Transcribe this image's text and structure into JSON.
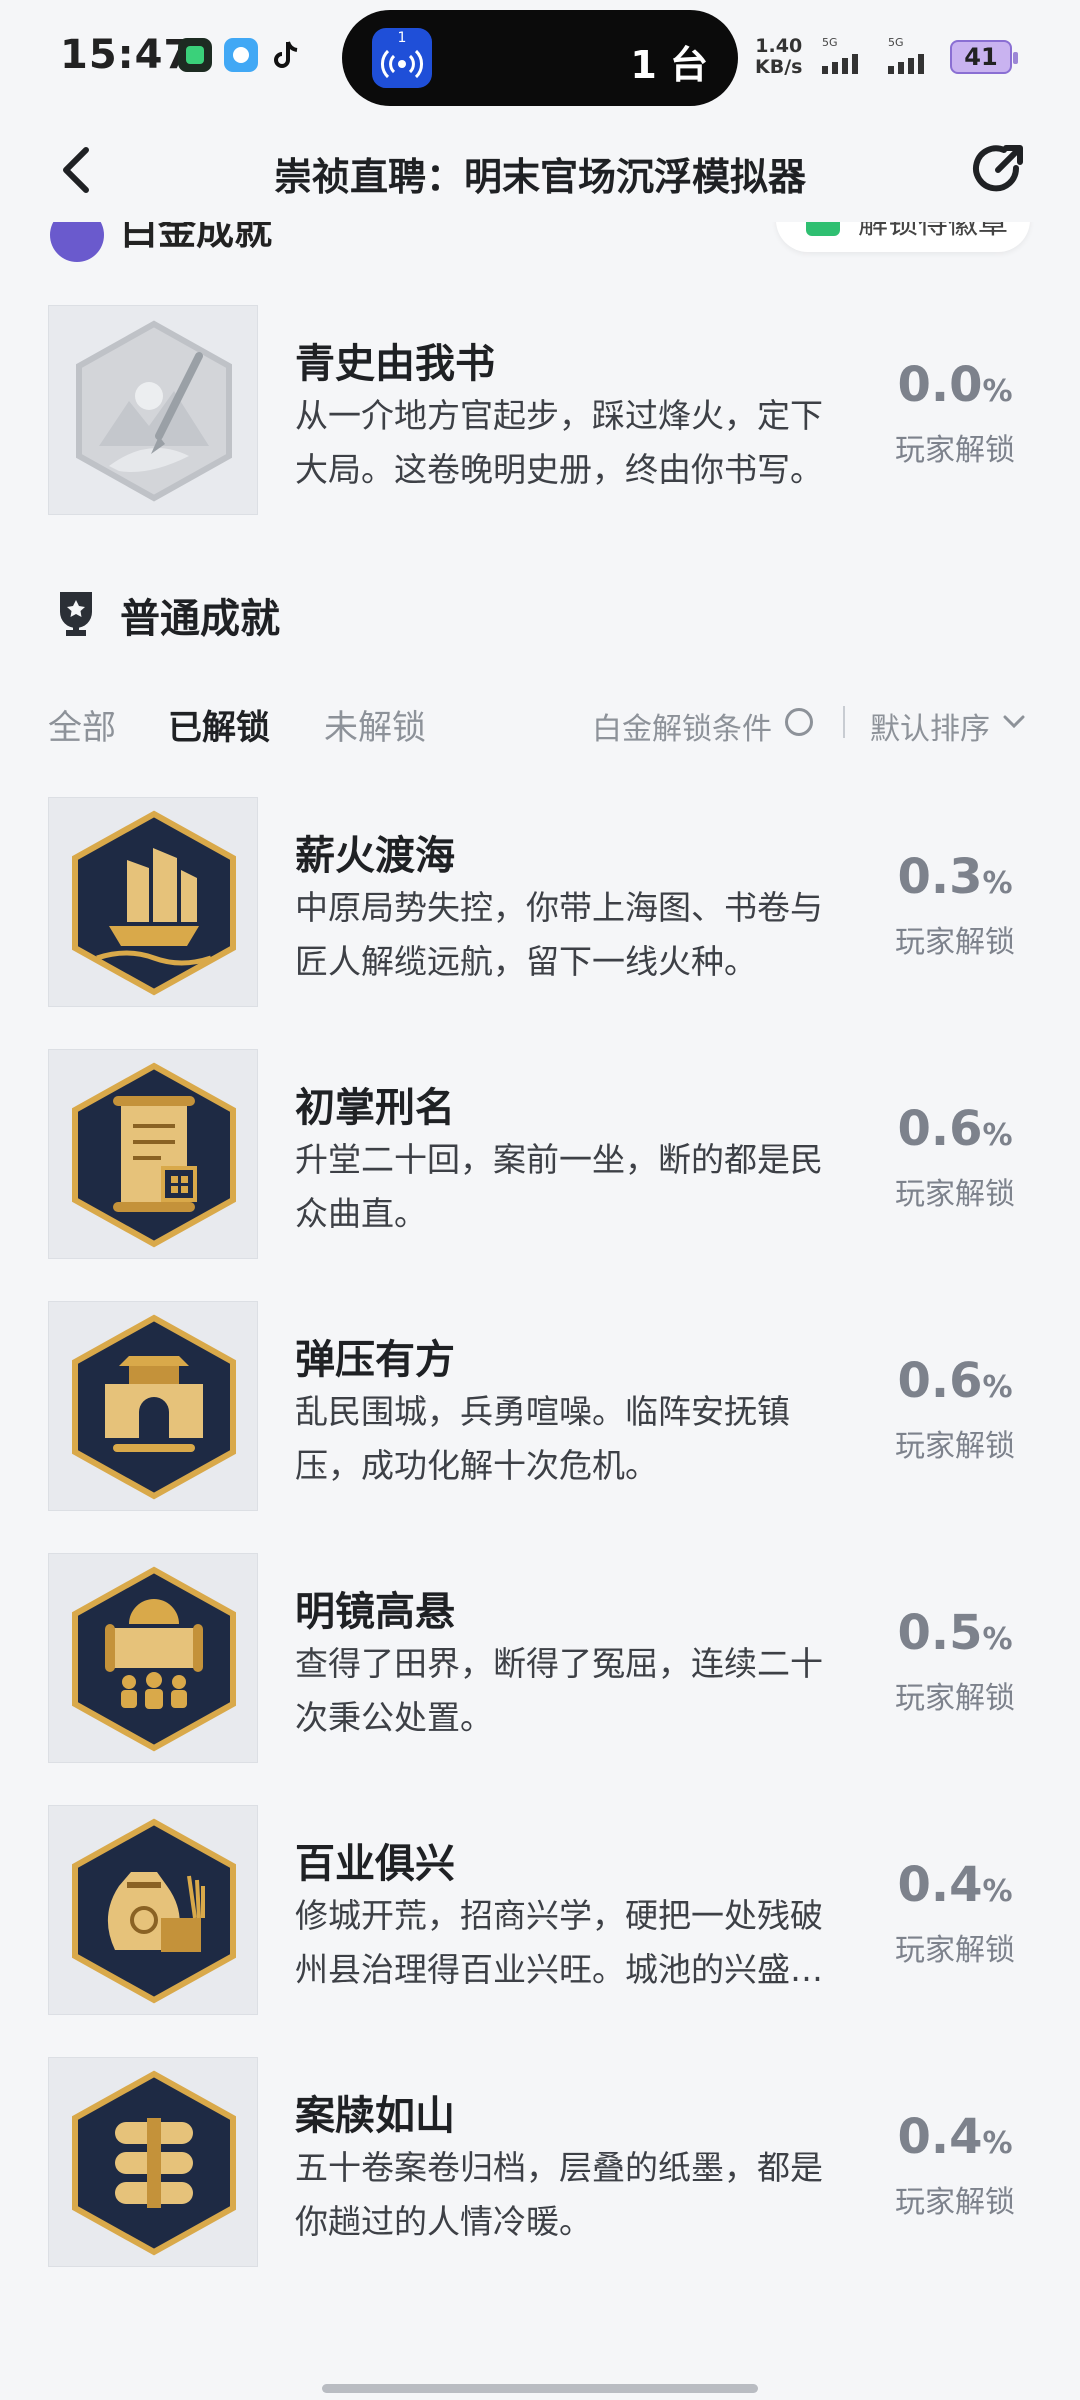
{
  "status_bar": {
    "time": "15:47",
    "island_text": "1 台",
    "island_badge": "1",
    "net_speed_value": "1.40",
    "net_speed_unit": "KB/s",
    "signal_1_label": "5G",
    "signal_2_label": "5G",
    "battery": "41"
  },
  "nav": {
    "title": "崇祯直聘：明末官场沉浮模拟器"
  },
  "platinum": {
    "title": "白金成就",
    "unlock_chip": "解锁得徽章",
    "item": {
      "title": "青史由我书",
      "desc": "从一介地方官起步，踩过烽火，定下大局。这卷晚明史册，终由你书写。",
      "pct": "0.0",
      "pct_unit": "%",
      "pct_label": "玩家解锁",
      "icon": "brush-landscape-icon"
    }
  },
  "common": {
    "title": "普通成就",
    "tabs": [
      "全部",
      "已解锁",
      "未解锁"
    ],
    "active_tab": "已解锁",
    "condition_label": "白金解锁条件",
    "sort_label": "默认排序",
    "items": [
      {
        "title": "薪火渡海",
        "desc": "中原局势失控，你带上海图、书卷与匠人解缆远航，留下一线火种。",
        "pct": "0.3",
        "pct_unit": "%",
        "pct_label": "玩家解锁",
        "icon": "junk-ship-icon"
      },
      {
        "title": "初掌刑名",
        "desc": "升堂二十回，案前一坐，断的都是民众曲直。",
        "pct": "0.6",
        "pct_unit": "%",
        "pct_label": "玩家解锁",
        "icon": "scroll-seal-icon"
      },
      {
        "title": "弹压有方",
        "desc": "乱民围城，兵勇喧噪。临阵安抚镇压，成功化解十次危机。",
        "pct": "0.6",
        "pct_unit": "%",
        "pct_label": "玩家解锁",
        "icon": "city-gate-icon"
      },
      {
        "title": "明镜高悬",
        "desc": "查得了田界，断得了冤屈，连续二十次秉公处置。",
        "pct": "0.5",
        "pct_unit": "%",
        "pct_label": "玩家解锁",
        "icon": "sun-scroll-people-icon"
      },
      {
        "title": "百业俱兴",
        "desc": "修城开荒，招商兴学，硬把一处残破州县治理得百业兴旺。城池的兴盛由你开创。",
        "pct": "0.4",
        "pct_unit": "%",
        "pct_label": "玩家解锁",
        "icon": "money-bag-icon"
      },
      {
        "title": "案牍如山",
        "desc": "五十卷案卷归档，层叠的纸墨，都是你趟过的人情冷暖。",
        "pct": "0.4",
        "pct_unit": "%",
        "pct_label": "玩家解锁",
        "icon": "stacked-scrolls-icon"
      }
    ]
  },
  "colors": {
    "badge_navy": "#1e2a44",
    "badge_gold": "#d9a94a",
    "muted_text": "#7d828c"
  }
}
